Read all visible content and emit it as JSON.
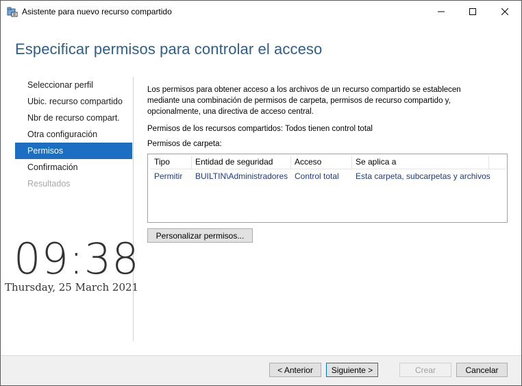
{
  "window": {
    "title": "Asistente para nuevo recurso compartido",
    "icon": "share-wizard-icon"
  },
  "header": {
    "title": "Especificar permisos para controlar el acceso"
  },
  "nav": {
    "items": [
      {
        "label": "Seleccionar perfil",
        "state": "normal"
      },
      {
        "label": "Ubic. recurso compartido",
        "state": "normal"
      },
      {
        "label": "Nbr de recurso compart.",
        "state": "normal"
      },
      {
        "label": "Otra configuración",
        "state": "normal"
      },
      {
        "label": "Permisos",
        "state": "active"
      },
      {
        "label": "Confirmación",
        "state": "normal"
      },
      {
        "label": "Resultados",
        "state": "disabled"
      }
    ]
  },
  "clock": {
    "time": "09:38",
    "date": "Thursday, 25 March 2021"
  },
  "main": {
    "description": "Los permisos para obtener acceso a los archivos de un recurso compartido se establecen mediante una combinación de permisos de carpeta, permisos de recurso compartido y, opcionalmente, una directiva de acceso central.",
    "share_permissions": "Permisos de los recursos compartidos: Todos tienen control total",
    "folder_permissions_label": "Permisos de carpeta:",
    "table": {
      "columns": [
        "Tipo",
        "Entidad de seguridad",
        "Acceso",
        "Se aplica a"
      ],
      "rows": [
        [
          "Permitir",
          "BUILTIN\\Administradores",
          "Control total",
          "Esta carpeta, subcarpetas y archivos"
        ]
      ]
    },
    "customize_button": "Personalizar permisos..."
  },
  "footer": {
    "back": "< Anterior",
    "next": "Siguiente >",
    "create": "Crear",
    "cancel": "Cancelar"
  },
  "colors": {
    "accent": "#1b6ec2",
    "header_text": "#2f5d8c",
    "link_text": "#1f3a8a"
  }
}
